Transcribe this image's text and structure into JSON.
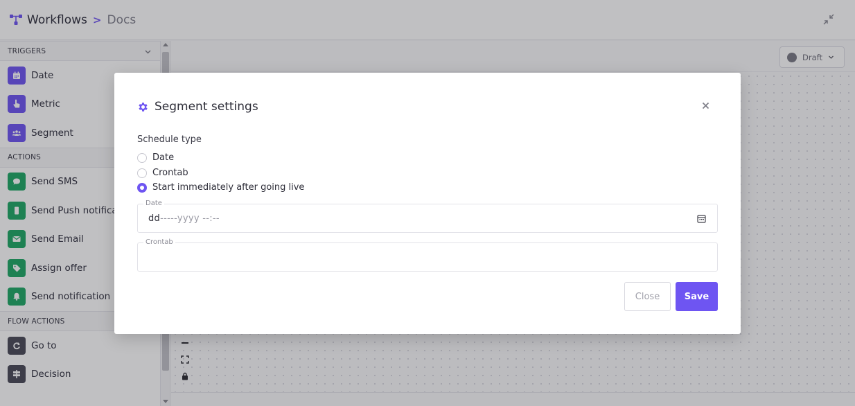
{
  "header": {
    "workflows_label": "Workflows",
    "separator": ">",
    "docs_label": "Docs",
    "app_icon": "workflow-icon",
    "collapse_icon": "collapse-icon"
  },
  "sidebar": {
    "sections": [
      {
        "title": "TRIGGERS",
        "items": [
          {
            "label": "Date",
            "icon": "calendar-icon",
            "color": "#6e55f2"
          },
          {
            "label": "Metric",
            "icon": "pointer-hand-icon",
            "color": "#6e55f2"
          },
          {
            "label": "Segment",
            "icon": "users-icon",
            "color": "#6e55f2"
          }
        ]
      },
      {
        "title": "ACTIONS",
        "items": [
          {
            "label": "Send SMS",
            "icon": "chat-bubble-icon",
            "color": "#1fa866"
          },
          {
            "label": "Send Push notificat",
            "icon": "mobile-icon",
            "color": "#1fa866"
          },
          {
            "label": "Send Email",
            "icon": "envelope-icon",
            "color": "#1fa866"
          },
          {
            "label": "Assign offer",
            "icon": "tag-icon",
            "color": "#1fa866"
          },
          {
            "label": "Send notification",
            "icon": "bell-icon",
            "color": "#1fa866"
          }
        ]
      },
      {
        "title": "FLOW ACTIONS",
        "items": [
          {
            "label": "Go to",
            "icon": "redo-icon",
            "color": "#4a4a58"
          },
          {
            "label": "Decision",
            "icon": "signpost-icon",
            "color": "#4a4a58"
          }
        ]
      }
    ]
  },
  "canvas": {
    "status_value": "Draft",
    "zoom_tools": [
      "−",
      "⛶",
      "🔒"
    ]
  },
  "modal": {
    "title": "Segment settings",
    "schedule_label": "Schedule type",
    "options": [
      {
        "label": "Date",
        "selected": false
      },
      {
        "label": "Crontab",
        "selected": false
      },
      {
        "label": "Start immediately after going live",
        "selected": true
      }
    ],
    "date_field": {
      "legend": "Date",
      "value_dd": "dd",
      "value_rest": "-----yyyy --:--"
    },
    "crontab_field": {
      "legend": "Crontab",
      "value": ""
    },
    "close_label": "Close",
    "save_label": "Save",
    "accent": "#6e55f2"
  }
}
